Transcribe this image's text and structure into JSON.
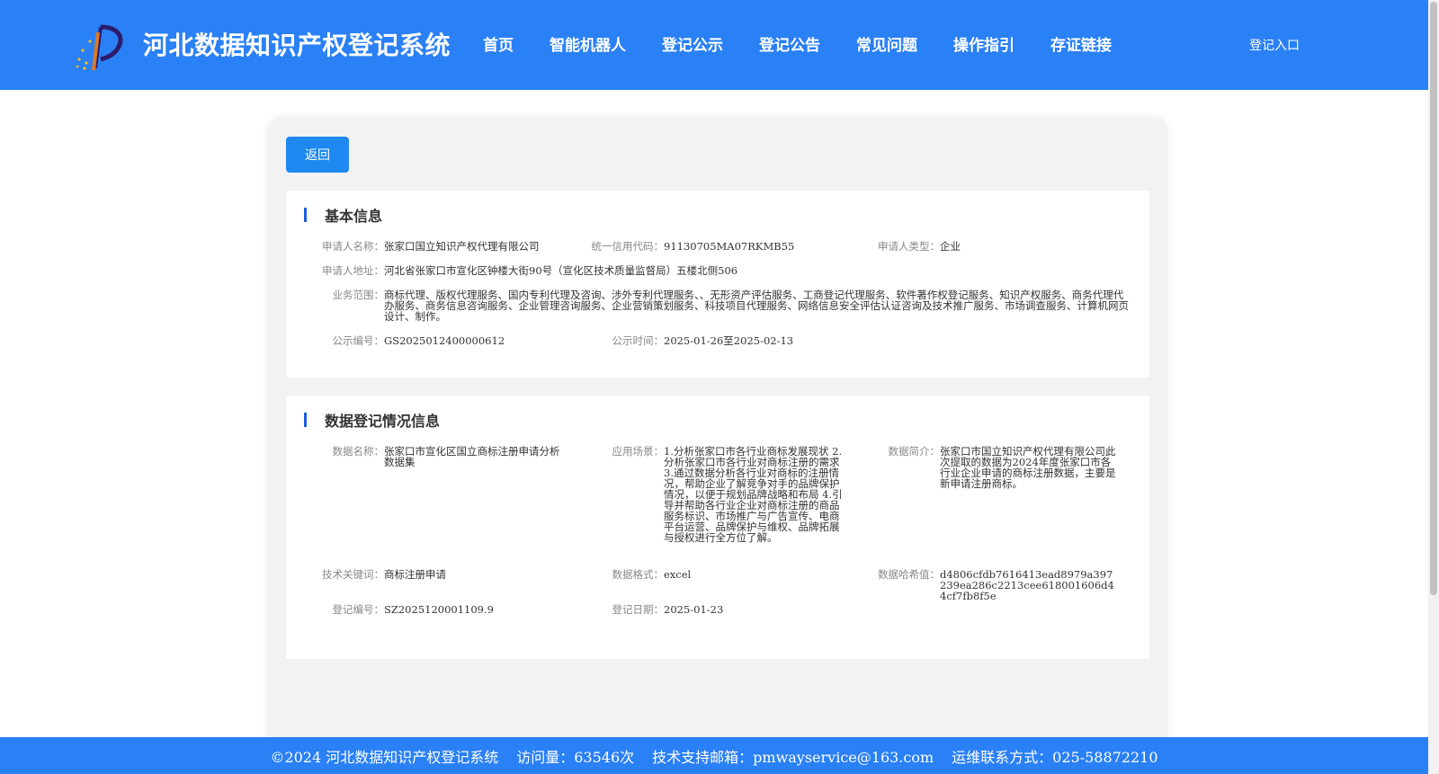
{
  "header": {
    "site_title": "河北数据知识产权登记系统",
    "nav": [
      "首页",
      "智能机器人",
      "登记公示",
      "登记公告",
      "常见问题",
      "操作指引",
      "存证链接"
    ],
    "login_label": "登记入口",
    "colors": {
      "bar": "#2a80f5",
      "accent": "#1e88f0",
      "title_marker": "#1e5fd8"
    }
  },
  "main": {
    "back_label": "返回",
    "basic_info": {
      "title": "基本信息",
      "applicant_name_label": "申请人名称：",
      "applicant_name": "张家口国立知识产权代理有限公司",
      "credit_code_label": "统一信用代码：",
      "credit_code": "91130705MA07RKMB55",
      "applicant_type_label": "申请人类型：",
      "applicant_type": "企业",
      "address_label": "申请人地址：",
      "address": "河北省张家口市宣化区钟楼大街90号（宣化区技术质量监督局）五楼北侧506",
      "scope_label": "业务范围：",
      "scope": "商标代理、版权代理服务、国内专利代理及咨询、涉外专利代理服务、、无形资产评估服务、工商登记代理服务、软件著作权登记服务、知识产权服务、商务代理代办服务、商务信息咨询服务、企业管理咨询服务、企业营销策划服务、科技项目代理服务、网络信息安全评估认证咨询及技术推广服务、市场调查服务、计算机网页设计、制作。",
      "notice_no_label": "公示编号：",
      "notice_no": "GS2025012400000612",
      "notice_time_label": "公示时间：",
      "notice_time": "2025-01-26至2025-02-13"
    },
    "data_info": {
      "title": "数据登记情况信息",
      "data_name_label": "数据名称：",
      "data_name": "张家口市宣化区国立商标注册申请分析数据集",
      "scenario_label": "应用场景：",
      "scenario": "1.分析张家口市各行业商标发展现状 2.分析张家口市各行业对商标注册的需求 3.通过数据分析各行业对商标的注册情况，帮助企业了解竞争对手的品牌保护情况，以便于规划品牌战略和布局 4.引导并帮助各行业企业对商标注册的商品服务标识、市场推广与广告宣传、电商平台运营、品牌保护与维权、品牌拓展与授权进行全方位了解。",
      "summary_label": "数据简介：",
      "summary": "张家口市国立知识产权代理有限公司此次提取的数据为2024年度张家口市各行业企业申请的商标注册数据，主要是新申请注册商标。",
      "keywords_label": "技术关键词：",
      "keywords": "商标注册申请",
      "format_label": "数据格式：",
      "format": "excel",
      "hash_label": "数据哈希值：",
      "hash": "d4806cfdb7616413ead8979a397239ea286c2213cee618001606d44cf7fb8f5e",
      "reg_no_label": "登记编号：",
      "reg_no": "SZ2025120001109.9",
      "reg_date_label": "登记日期：",
      "reg_date": "2025-01-23"
    }
  },
  "footer": {
    "copyright": "©2024 河北数据知识产权登记系统",
    "visits": "访问量：63546次",
    "email": "技术支持邮箱：pmwayservice@163.com",
    "phone": "运维联系方式：025-58872210"
  }
}
